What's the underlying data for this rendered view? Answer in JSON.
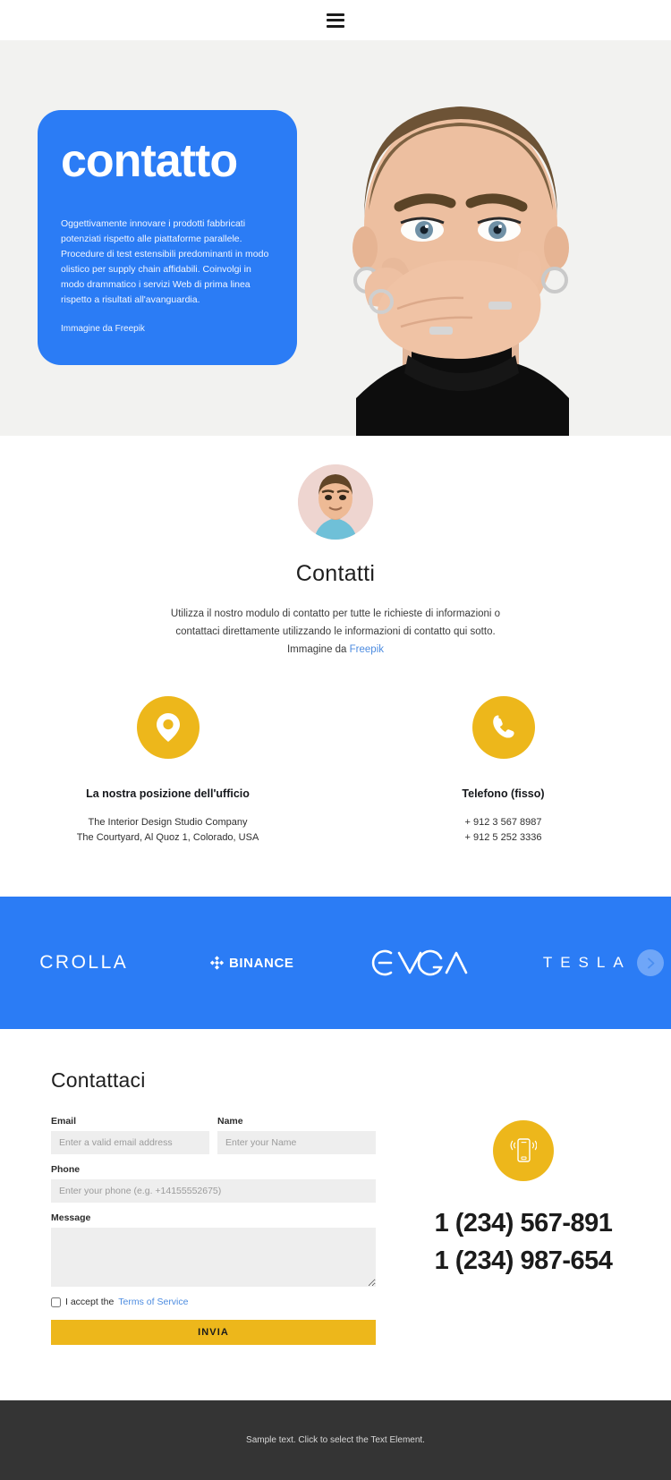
{
  "header": {
    "menu_icon": "hamburger-menu-icon"
  },
  "hero": {
    "title": "contatto",
    "body": "Oggettivamente innovare i prodotti fabbricati potenziati rispetto alle piattaforme parallele. Procedure di test estensibili predominanti in modo olistico per supply chain affidabili. Coinvolgi in modo drammatico i servizi Web di prima linea rispetto a risultati all'avanguardia.",
    "credit": "Immagine da Freepik",
    "card_color": "#2b7cf5",
    "background_color": "#f2f2f0",
    "photo_alt": "woman-covering-mouth-photo"
  },
  "intro": {
    "avatar_alt": "person-avatar",
    "title": "Contatti",
    "text": "Utilizza il nostro modulo di contatto per tutte le richieste di informazioni o contattaci direttamente utilizzando le informazioni di contatto qui sotto.",
    "credit_prefix": "Immagine da ",
    "credit_link": "Freepik",
    "link_color": "#4d8ce0"
  },
  "contact_blocks": [
    {
      "icon": "map-pin-icon",
      "title": "La nostra posizione dell'ufficio",
      "lines": [
        "The Interior Design Studio Company",
        "The Courtyard, Al Quoz 1, Colorado,  USA"
      ]
    },
    {
      "icon": "phone-handset-icon",
      "title": "Telefono (fisso)",
      "lines": [
        "+ 912 3 567 8987",
        "+ 912 5 252 3336"
      ]
    }
  ],
  "logo_strip": {
    "background_color": "#2b7cf5",
    "logos": [
      {
        "name": "CROLLA",
        "icon": "crolla-logo"
      },
      {
        "name": "BINANCE",
        "icon": "binance-logo"
      },
      {
        "name": "EVGA",
        "icon": "evga-logo"
      },
      {
        "name": "TESLA",
        "icon": "tesla-logo"
      }
    ],
    "next_label": "next-slide-icon"
  },
  "form": {
    "title": "Contattaci",
    "fields": {
      "email": {
        "label": "Email",
        "placeholder": "Enter a valid email address",
        "value": ""
      },
      "name": {
        "label": "Name",
        "placeholder": "Enter your Name",
        "value": ""
      },
      "phone": {
        "label": "Phone",
        "placeholder": "Enter your phone (e.g. +14155552675)",
        "value": ""
      },
      "message": {
        "label": "Message",
        "placeholder": "",
        "value": ""
      }
    },
    "accept_prefix": "I accept the ",
    "accept_link": "Terms of Service",
    "accept_checked": false,
    "submit_label": "INVIA",
    "submit_color": "#edb71b"
  },
  "side_contact": {
    "icon": "mobile-phone-ring-icon",
    "icon_color": "#edb71b",
    "phone_1": "1 (234) 567-891",
    "phone_2": "1 (234) 987-654"
  },
  "footer": {
    "text": "Sample text. Click to select the Text Element.",
    "background_color": "#343434"
  }
}
